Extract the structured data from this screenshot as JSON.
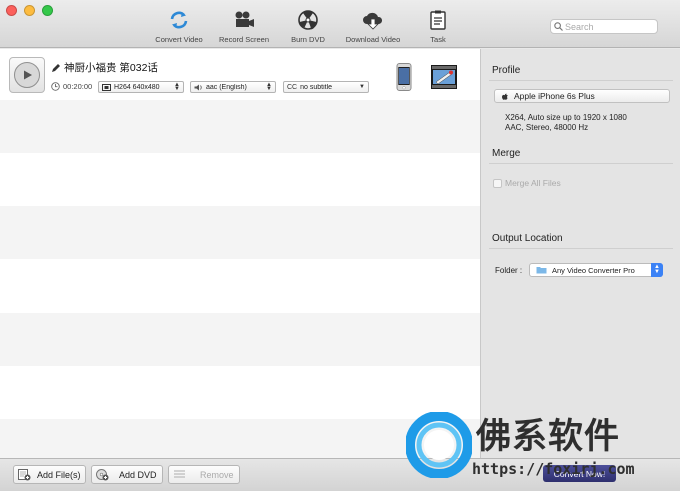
{
  "toolbar": {
    "items": [
      {
        "label": "Convert Video"
      },
      {
        "label": "Record Screen"
      },
      {
        "label": "Burn DVD"
      },
      {
        "label": "Download Video"
      },
      {
        "label": "Task"
      }
    ],
    "search_placeholder": "Search"
  },
  "file": {
    "title": "神厨小福贵 第032话",
    "duration": "00:20:00",
    "video": "H264 640x480",
    "audio": "aac (English)",
    "subtitle": "no subtitle",
    "subtitle_tag": "CC"
  },
  "panel": {
    "profile_heading": "Profile",
    "profile_value": "Apple iPhone 6s Plus",
    "profile_desc_line1": "X264, Auto size up to 1920 x 1080",
    "profile_desc_line2": "AAC, Stereo, 48000 Hz",
    "merge_heading": "Merge",
    "merge_label": "Merge All Files",
    "output_heading": "Output Location",
    "folder_label": "Folder :",
    "folder_value": "Any Video Converter Pro"
  },
  "bottom": {
    "add_files": "Add File(s)",
    "add_dvd": "Add DVD",
    "remove": "Remove",
    "convert": "Convert Now!"
  },
  "watermark": {
    "text": "佛系软件",
    "url": "https://foxirj.com"
  },
  "colors": {
    "accent": "#3b82f6",
    "convert_button": "#2e2f6e"
  }
}
